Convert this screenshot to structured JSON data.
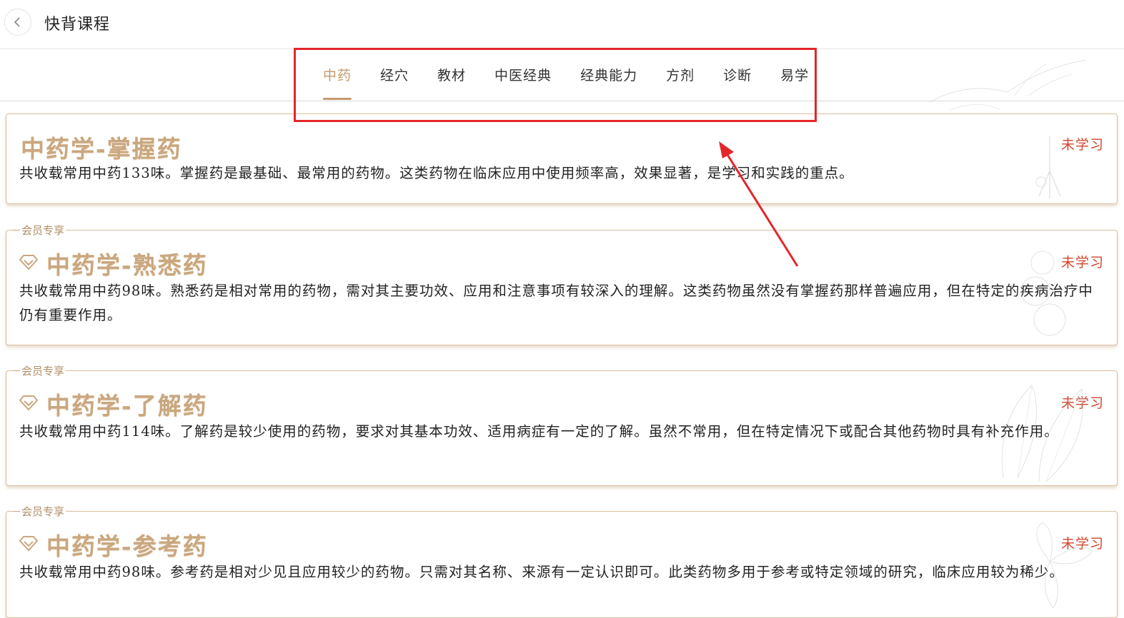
{
  "header": {
    "title": "快背课程",
    "back_icon": "chevron-left-icon"
  },
  "tabs": [
    {
      "label": "中药",
      "active": true
    },
    {
      "label": "经穴",
      "active": false
    },
    {
      "label": "教材",
      "active": false
    },
    {
      "label": "中医经典",
      "active": false
    },
    {
      "label": "经典能力",
      "active": false
    },
    {
      "label": "方剂",
      "active": false
    },
    {
      "label": "诊断",
      "active": false
    },
    {
      "label": "易学",
      "active": false
    }
  ],
  "courses": [
    {
      "title": "中药学-掌握药",
      "status": "未学习",
      "vip": "",
      "desc": "共收载常用中药133味。掌握药是最基础、最常用的药物。这类药物在临床应用中使用频率高，效果显著，是学习和实践的重点。"
    },
    {
      "title": "中药学-熟悉药",
      "status": "未学习",
      "vip": "会员专享",
      "desc": "共收载常用中药98味。熟悉药是相对常用的药物，需对其主要功效、应用和注意事项有较深入的理解。这类药物虽然没有掌握药那样普遍应用，但在特定的疾病治疗中仍有重要作用。"
    },
    {
      "title": "中药学-了解药",
      "status": "未学习",
      "vip": "会员专享",
      "desc": "共收载常用中药114味。了解药是较少使用的药物，要求对其基本功效、适用病症有一定的了解。虽然不常用，但在特定情况下或配合其他药物时具有补充作用。"
    },
    {
      "title": "中药学-参考药",
      "status": "未学习",
      "vip": "会员专享",
      "desc": "共收载常用中药98味。参考药是相对少见且应用较少的药物。只需对其名称、来源有一定认识即可。此类药物多用于参考或特定领域的研究，临床应用较为稀少。"
    }
  ],
  "colors": {
    "accent": "#c49a6c",
    "status": "#d2462a",
    "annotation": "#e3262b"
  }
}
